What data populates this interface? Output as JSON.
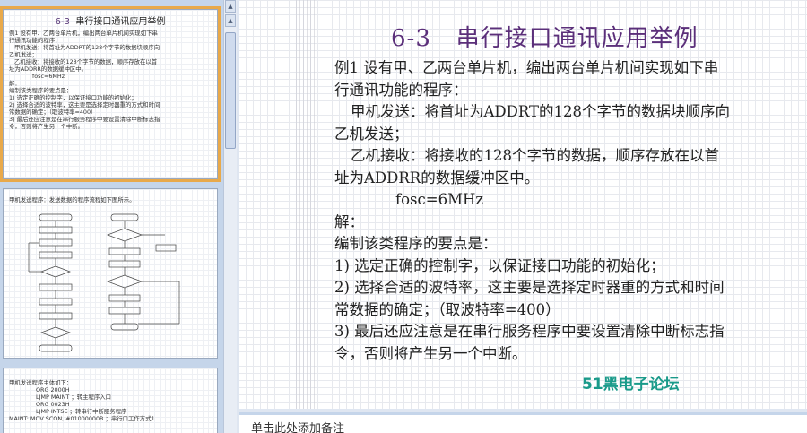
{
  "thumbnails": {
    "slide1": {
      "number": "6-3",
      "title": "串行接口通讯应用举例",
      "lines": [
        "例1 设有甲、乙两台单片机，编出两台单片机间实现如下串",
        "行通讯功能的程序：",
        "甲机发送：将首址为ADDRT的128个字节的数据块顺序向",
        "乙机发送；",
        "乙机接收：将接收的128个字节的数据，顺序存放在以首",
        "址为ADDRR的数据缓冲区中。",
        "fosc=6MHz",
        "解：",
        "编制该类程序的要点是：",
        "1) 选定正确的控制字，以保证接口功能的初始化；",
        "2) 选择合适的波特率，这主要是选择定时器重的方式和时间",
        "常数据的确定；（取波特率=400）",
        "3) 最后还应注意是在串行服务程序中要设置清除中断标志指",
        "令，否则将产生另一个中断。"
      ]
    },
    "slide2": {
      "caption": "甲机发送程序：发送数据的程序流程如下图所示。"
    },
    "slide3": {
      "caption": "甲机发送程序主体如下：",
      "code": [
        "ORG  2000H",
        "LJMP  MAINT        ；转主程序入口",
        "ORG  0023H",
        "LJMP  INTSE         ；转串行中断服务程序",
        "MAINT:  MOV   SCON,  #01000000B  ；串行口工作方式1"
      ]
    }
  },
  "slide": {
    "number": "6-3",
    "title": "串行接口通讯应用举例",
    "lines": [
      "例1 设有甲、乙两台单片机，编出两台单片机间实现如下串",
      "行通讯功能的程序：",
      "甲机发送：将首址为ADDRT的128个字节的数据块顺序向",
      "乙机发送；",
      "乙机接收：将接收的128个字节的数据，顺序存放在以首",
      "址为ADDRR的数据缓冲区中。",
      "fosc=6MHz",
      "解：",
      "编制该类程序的要点是：",
      "1) 选定正确的控制字，以保证接口功能的初始化；",
      "2) 选择合适的波特率，这主要是选择定时器重的方式和时间",
      "常数据的确定；（取波特率=400）",
      "3) 最后还应注意是在串行服务程序中要设置清除中断标志指",
      "令，否则将产生另一个中断。"
    ],
    "watermark": "51黑电子论坛"
  },
  "notes": {
    "placeholder": "单击此处添加备注"
  },
  "colors": {
    "title": "#5b2f7a",
    "watermark": "#1a9a8a",
    "selection": "#e9a94a",
    "pane": "#c5d5ea"
  }
}
